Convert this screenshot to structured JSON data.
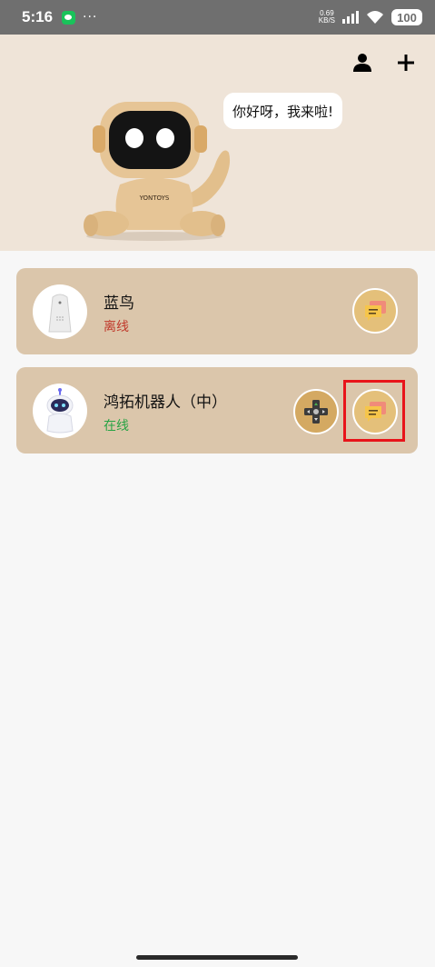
{
  "status_bar": {
    "time": "5:16",
    "more": "···",
    "net_speed_value": "0.69",
    "net_speed_unit": "KB/S",
    "battery": "100"
  },
  "hero": {
    "greeting": "你好呀，我来啦!",
    "robot_brand": "YONTOYS"
  },
  "devices": [
    {
      "name": "蓝鸟",
      "status": "离线",
      "status_color": "#c0392b"
    },
    {
      "name": "鸿拓机器人（中）",
      "status": "在线",
      "status_color": "#27a344"
    }
  ],
  "colors": {
    "hero_bg": "#efe4d8",
    "card_bg": "#dbc6ab",
    "chat_btn": "#e4c07a",
    "highlight": "#e8141a"
  }
}
